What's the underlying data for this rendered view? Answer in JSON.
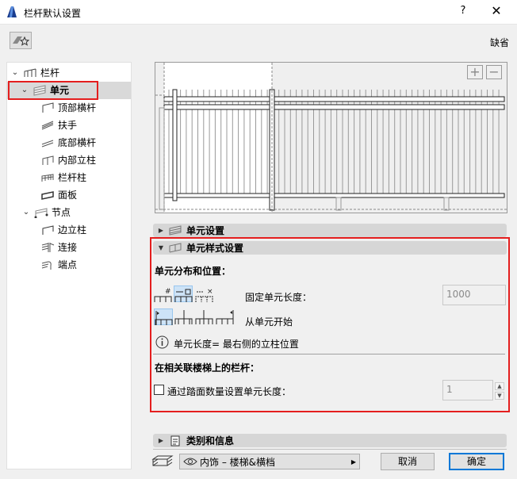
{
  "window": {
    "title": "栏杆默认设置",
    "help": "?",
    "close": "✕"
  },
  "toolbar": {
    "default_label": "缺省"
  },
  "tree": {
    "railing": "栏杆",
    "segment": "单元",
    "segment_children": [
      "顶部横杆",
      "扶手",
      "底部横杆",
      "内部立柱",
      "栏杆柱",
      "面板"
    ],
    "node": "节点",
    "node_children": [
      "边立柱",
      "连接",
      "端点"
    ]
  },
  "preview": {
    "zoom_in": "+",
    "zoom_out": "−"
  },
  "sections": {
    "segment_settings": "单元设置",
    "segment_pattern": "单元样式设置",
    "classification": "类别和信息"
  },
  "pattern": {
    "distribution_heading": "单元分布和位置：",
    "fixed_length_label": "固定单元长度：",
    "fixed_length_value": "1000",
    "start_label": "从单元开始",
    "info_text": "单元长度= 最右侧的立柱位置",
    "stair_heading": "在相关联楼梯上的栏杆：",
    "tread_checkbox_label": "通过踏面数量设置单元长度：",
    "tread_checked": false,
    "tread_value": "1"
  },
  "footer": {
    "layer": "内饰 – 楼梯&横档",
    "cancel": "取消",
    "ok": "确定"
  },
  "colors": {
    "highlight": "#e41e1e",
    "accent": "#0078d7",
    "selected_tool": "#cde3f7"
  }
}
